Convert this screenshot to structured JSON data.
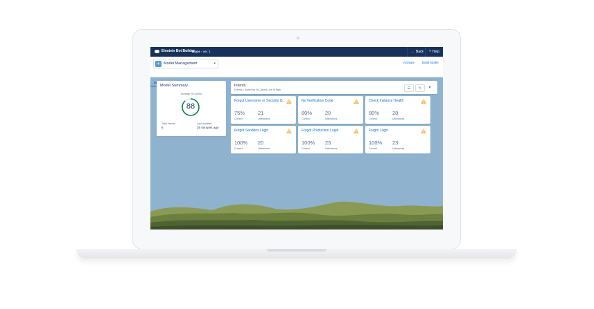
{
  "topbar": {
    "app_name": "Einstein Bot Builder",
    "bot_name": "Blaze",
    "version": " - ver. 1",
    "back_label": "Back",
    "help_label": "Help"
  },
  "header": {
    "model_select_value": "Model Management",
    "activate_label": "Activate",
    "build_model_label": "Build Model",
    "tabs": [
      {
        "label": "Model"
      },
      {
        "label": "Bot Training"
      }
    ]
  },
  "summary": {
    "title": "Model Summary",
    "gauge_label": "Average % Correct",
    "gauge_value": "88",
    "gauge_fraction": 0.88,
    "total_intents_label": "Total Intents",
    "total_intents_value": "6",
    "last_updated_label": "Last Updated",
    "last_updated_value": "26 minutes ago"
  },
  "intents": {
    "title": "Intents",
    "subtitle": "6 items • Sorted by % Correct Low to High",
    "correct_label": "Correct",
    "utterances_label": "Utterances",
    "items": [
      {
        "name": "Forgot Username or Security Q...",
        "correct": "75%",
        "utterances": "21",
        "warning": true
      },
      {
        "name": "No Verification Code",
        "correct": "80%",
        "utterances": "20",
        "warning": true
      },
      {
        "name": "Check Instance Health",
        "correct": "80%",
        "utterances": "28",
        "warning": true
      },
      {
        "name": "Forgot Sandbox Login",
        "correct": "100%",
        "utterances": "20",
        "warning": true
      },
      {
        "name": "Forgot Production Login",
        "correct": "100%",
        "utterances": "23",
        "warning": true
      },
      {
        "name": "Forgot Login",
        "correct": "100%",
        "utterances": "23",
        "warning": true
      }
    ]
  },
  "colors": {
    "nav": "#16325c",
    "link": "#0070d2",
    "gauge": "#04844b",
    "warning": "#ffb75d",
    "background": "#8fb3cf"
  }
}
